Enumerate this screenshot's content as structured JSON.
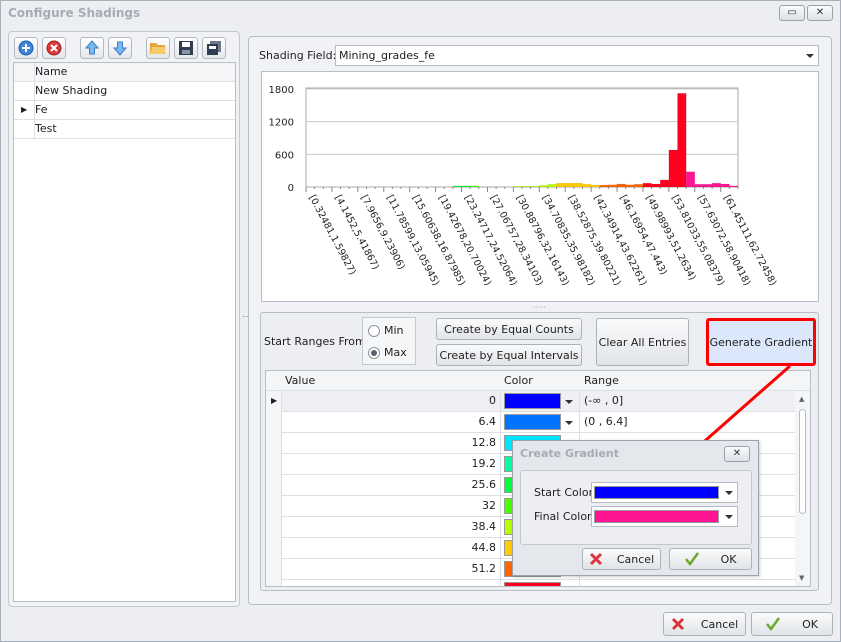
{
  "window": {
    "title": "Configure Shadings",
    "restore_glyph": "▭",
    "close_glyph": "✕"
  },
  "toolbar": {
    "icons": [
      "add-icon",
      "delete-icon",
      "move-up-icon",
      "move-down-icon",
      "open-folder-icon",
      "save-icon",
      "save-all-icon"
    ]
  },
  "shadings": {
    "header": "Name",
    "items": [
      {
        "name": "New Shading",
        "selected": false
      },
      {
        "name": "Fe",
        "selected": true
      },
      {
        "name": "Test",
        "selected": false
      }
    ]
  },
  "shading_field": {
    "label": "Shading Field:",
    "value": "Mining_grades_fe"
  },
  "controls": {
    "start_ranges_label": "Start Ranges From:",
    "min_label": "Min",
    "max_label": "Max",
    "selected": "Max",
    "equal_counts": "Create by Equal Counts",
    "equal_intervals": "Create by Equal Intervals",
    "clear_all": "Clear All Entries",
    "generate_gradient": "Generate Gradient"
  },
  "table": {
    "headers": {
      "value": "Value",
      "color": "Color",
      "range": "Range"
    },
    "rows": [
      {
        "value": "0",
        "color": "#0000ff",
        "range": "(-∞ , 0]"
      },
      {
        "value": "6.4",
        "color": "#0073ff",
        "range": "(0 , 6.4]"
      },
      {
        "value": "12.8",
        "color": "#00e6ff",
        "range": ""
      },
      {
        "value": "19.2",
        "color": "#00ffa0",
        "range": ""
      },
      {
        "value": "25.6",
        "color": "#00ff3c",
        "range": ""
      },
      {
        "value": "32",
        "color": "#46ff00",
        "range": ""
      },
      {
        "value": "38.4",
        "color": "#b8ff00",
        "range": ""
      },
      {
        "value": "44.8",
        "color": "#ffcc00",
        "range": ""
      },
      {
        "value": "51.2",
        "color": "#ff6600",
        "range": ""
      },
      {
        "value": "",
        "color": "#ff001e",
        "range": ""
      }
    ]
  },
  "dialog": {
    "title": "Create Gradient",
    "close_glyph": "✕",
    "start_label": "Start Color",
    "start_color": "#0000ff",
    "final_label": "Final Color",
    "final_color": "#ff1493",
    "cancel": "Cancel",
    "ok": "OK"
  },
  "footer": {
    "cancel": "Cancel",
    "ok": "OK"
  },
  "chart_data": {
    "type": "bar",
    "title": "",
    "xlabel": "",
    "ylabel": "",
    "ylim": [
      0,
      1800
    ],
    "yticks": [
      "0",
      "600",
      "1200",
      "1800"
    ],
    "bin_start": 0.32481,
    "bin_width": 1.2735,
    "overflow_color": "#ff1493",
    "tick_labels": [
      "[0.32481,1.59827)",
      "[4.1452,5.41867)",
      "[7.9656,9.23906)",
      "[11.78599,13.05945)",
      "[15.60638,16.87985)",
      "[19.42678,20.70024)",
      "[23.24717,24.52064)",
      "[27.06757,28.34103)",
      "[30.88796,32.16143)",
      "[34.70835,35.98182)",
      "[38.52875,39.80221)",
      "[42.34914,43.62261)",
      "[46.16954,47.443)",
      "[49.98993,51.2634)",
      "[53.81033,55.08379)",
      "[57.63072,58.90418)",
      "[61.45111,62.72458)"
    ],
    "values": [
      0,
      0,
      0,
      0,
      0,
      0,
      0,
      0,
      0,
      0,
      0,
      0,
      0,
      0,
      0,
      0,
      0,
      20,
      20,
      20,
      0,
      0,
      0,
      0,
      15,
      15,
      15,
      30,
      50,
      70,
      70,
      70,
      50,
      35,
      35,
      40,
      55,
      40,
      50,
      70,
      55,
      130,
      680,
      1720,
      280,
      50,
      50,
      70,
      55,
      20
    ]
  }
}
